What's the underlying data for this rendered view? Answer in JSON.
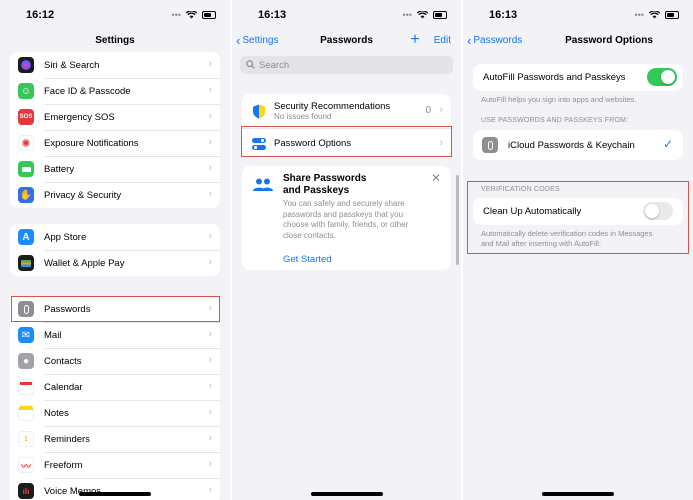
{
  "screen1": {
    "time": "16:12",
    "title": "Settings",
    "group_a": [
      {
        "label": "Siri & Search",
        "icon": "siri-icon",
        "color": "#1c1c1e"
      },
      {
        "label": "Face ID & Passcode",
        "icon": "face-id-icon",
        "color": "#34c759"
      },
      {
        "label": "Emergency SOS",
        "icon": "sos-icon",
        "color": "#e5383b",
        "glyph": "SOS"
      },
      {
        "label": "Exposure Notifications",
        "icon": "exposure-icon",
        "color": "#ffffff"
      },
      {
        "label": "Battery",
        "icon": "battery-icon",
        "color": "#34c759"
      },
      {
        "label": "Privacy & Security",
        "icon": "hand-icon",
        "color": "#2f6ff0"
      }
    ],
    "group_b": [
      {
        "label": "App Store",
        "icon": "app-store-icon",
        "color": "#1a8cff"
      },
      {
        "label": "Wallet & Apple Pay",
        "icon": "wallet-icon",
        "color": "#1c1c1e"
      }
    ],
    "group_c": [
      {
        "label": "Passwords",
        "icon": "key-icon",
        "color": "#8e8e93"
      },
      {
        "label": "Mail",
        "icon": "mail-icon",
        "color": "#1a8cff"
      },
      {
        "label": "Contacts",
        "icon": "contacts-icon",
        "color": "#a2a2a7"
      },
      {
        "label": "Calendar",
        "icon": "calendar-icon",
        "color": "#ffffff"
      },
      {
        "label": "Notes",
        "icon": "notes-icon",
        "color": "#ffd60a"
      },
      {
        "label": "Reminders",
        "icon": "reminders-icon",
        "color": "#ffffff"
      },
      {
        "label": "Freeform",
        "icon": "freeform-icon",
        "color": "#ffffff"
      },
      {
        "label": "Voice Memos",
        "icon": "voice-memos-icon",
        "color": "#1c1c1e"
      }
    ]
  },
  "screen2": {
    "time": "16:13",
    "back": "Settings",
    "title": "Passwords",
    "plus": "+",
    "edit": "Edit",
    "search_placeholder": "Search",
    "security": {
      "label": "Security Recommendations",
      "sub": "No issues found",
      "count": "0"
    },
    "options_label": "Password Options",
    "share": {
      "title_line1": "Share Passwords",
      "title_line2": "and Passkeys",
      "body_lines": [
        "You can safely and securely share",
        "passwords and passkeys that you",
        "choose with family, friends, or other",
        "close contacts."
      ],
      "link": "Get Started"
    }
  },
  "screen3": {
    "time": "16:13",
    "back": "Passwords",
    "title": "Password Options",
    "autofill": {
      "label": "AutoFill Passwords and Passkeys",
      "on": true
    },
    "autofill_caption": "AutoFill helps you sign into apps and websites.",
    "use_header": "USE PASSWORDS AND PASSKEYS FROM:",
    "icloud_label": "iCloud Passwords & Keychain",
    "check": "✓",
    "verif_header": "VERIFICATION CODES",
    "cleanup": {
      "label": "Clean Up Automatically",
      "on": false
    },
    "cleanup_caption_lines": [
      "Automatically delete verification codes in Messages",
      "and Mail after inserting with AutoFill."
    ]
  },
  "colors": {
    "accent": "#1476f0",
    "toggle_on": "#34c759",
    "highlight": "#d9534f"
  }
}
